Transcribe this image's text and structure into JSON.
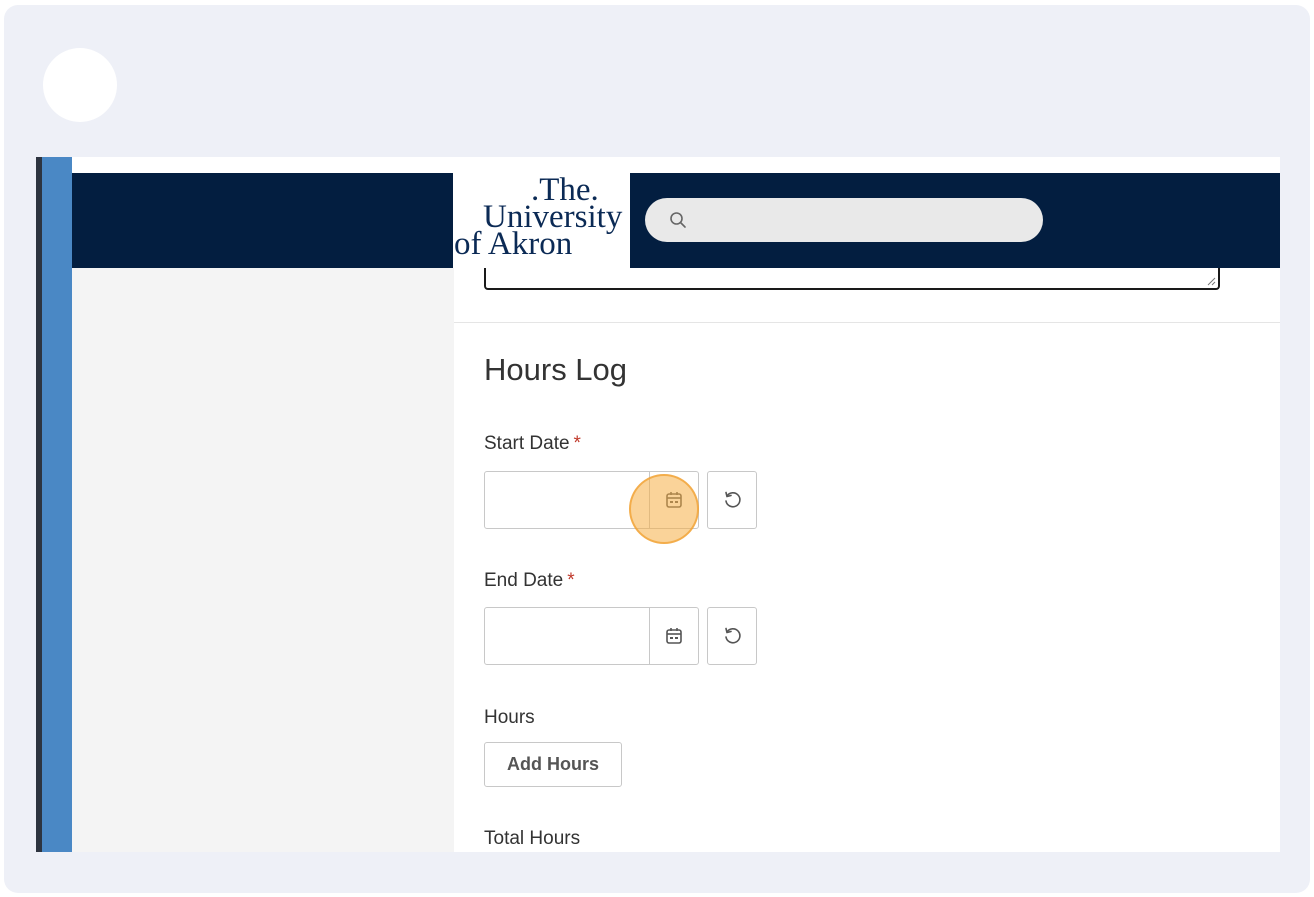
{
  "header": {
    "logo": {
      "line1": ".The.",
      "line2": "University",
      "line3": "of Akron"
    },
    "search": {
      "placeholder": ""
    }
  },
  "form": {
    "section_title": "Hours Log",
    "start_date": {
      "label": "Start Date",
      "required_marker": "*",
      "value": ""
    },
    "end_date": {
      "label": "End Date",
      "required_marker": "*",
      "value": ""
    },
    "hours": {
      "label": "Hours",
      "add_button_label": "Add Hours"
    },
    "total_hours": {
      "label": "Total Hours"
    }
  },
  "icons": {
    "search": "search-icon",
    "calendar": "calendar-icon",
    "reset": "reset-icon"
  },
  "colors": {
    "header_bg": "#031e40",
    "left_rail": "#4a88c5",
    "required": "#c0392b",
    "click_highlight": "#f5af46"
  }
}
